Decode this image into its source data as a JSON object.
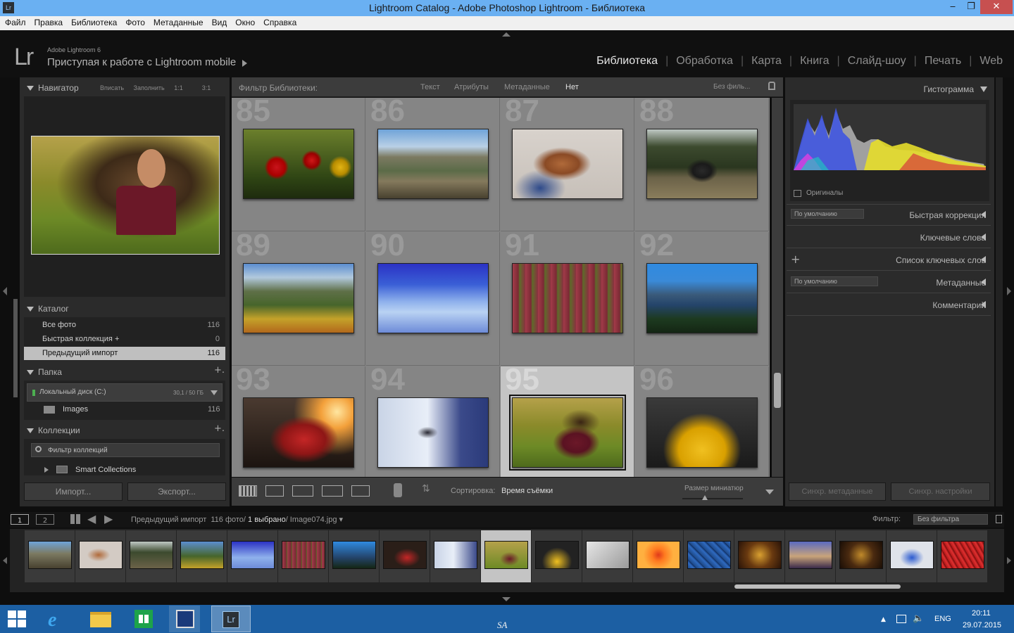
{
  "window": {
    "title": "Lightroom Catalog - Adobe Photoshop Lightroom - Библиотека",
    "app_icon": "Lr",
    "min": "‒",
    "max": "❐",
    "close": "✕"
  },
  "menu": [
    "Файл",
    "Правка",
    "Библиотека",
    "Фото",
    "Метаданные",
    "Вид",
    "Окно",
    "Справка"
  ],
  "identity": {
    "logo": "Lr",
    "version": "Adobe Lightroom 6",
    "mobile": "Приступая к работе с Lightroom mobile"
  },
  "modules": [
    "Библиотека",
    "Обработка",
    "Карта",
    "Книга",
    "Слайд-шоу",
    "Печать",
    "Web"
  ],
  "navigator": {
    "title": "Навигатор",
    "opts": [
      "Вписать",
      "Заполнить",
      "1:1",
      "3:1"
    ]
  },
  "catalog": {
    "title": "Каталог",
    "items": [
      {
        "label": "Все фото",
        "count": "116"
      },
      {
        "label": "Быстрая коллекция +",
        "count": "0"
      },
      {
        "label": "Предыдущий импорт",
        "count": "116"
      }
    ]
  },
  "folders": {
    "title": "Папка",
    "plus": "+.",
    "disk": "Локальный диск (C:)",
    "disk_size": "30,1 / 50 ГБ",
    "folder": "Images",
    "folder_count": "116"
  },
  "collections": {
    "title": "Коллекции",
    "plus": "+.",
    "filter": "Фильтр коллекций",
    "smart": "Smart Collections"
  },
  "buttons": {
    "import": "Импорт...",
    "export": "Экспорт..."
  },
  "filterbar": {
    "label": "Фильтр Библиотеки:",
    "items": [
      "Текст",
      "Атрибуты",
      "Метаданные",
      "Нет"
    ],
    "preset": "Без филь..."
  },
  "grid": {
    "numbers": [
      "85",
      "86",
      "87",
      "88",
      "89",
      "90",
      "91",
      "92",
      "93",
      "94",
      "95",
      "96"
    ],
    "selected_index": 10
  },
  "toolbar": {
    "sort_label": "Сортировка:",
    "sort_value": "Время съёмки",
    "thumb_label": "Размер миниатюр"
  },
  "right": {
    "histogram": "Гистограмма",
    "originals": "Оригиналы",
    "preset_default": "По умолчанию",
    "quick": "Быстрая коррекция",
    "keywords": "Ключевые слова",
    "keywordlist": "Список ключевых слов",
    "metadata": "Метаданные",
    "comments": "Комментарий",
    "sync_meta": "Синхр. метаданные",
    "sync_settings": "Синхр. настройки"
  },
  "filmstrip_bar": {
    "mon1": "1",
    "mon2": "2",
    "source": "Предыдущий импорт",
    "count": "116 фото/",
    "selected": "1 выбрано",
    "file": "/ Image074.jpg",
    "filter_label": "Фильтр:",
    "filter_value": "Без фильтра"
  },
  "taskbar": {
    "lang": "ENG",
    "time": "20:11",
    "date": "29.07.2015",
    "watermark": "SA"
  },
  "colors": {
    "titlebar": "#6ab0f2",
    "taskbar": "#1c5fa3",
    "panel": "#2b2b2b",
    "grid": "#858585"
  }
}
